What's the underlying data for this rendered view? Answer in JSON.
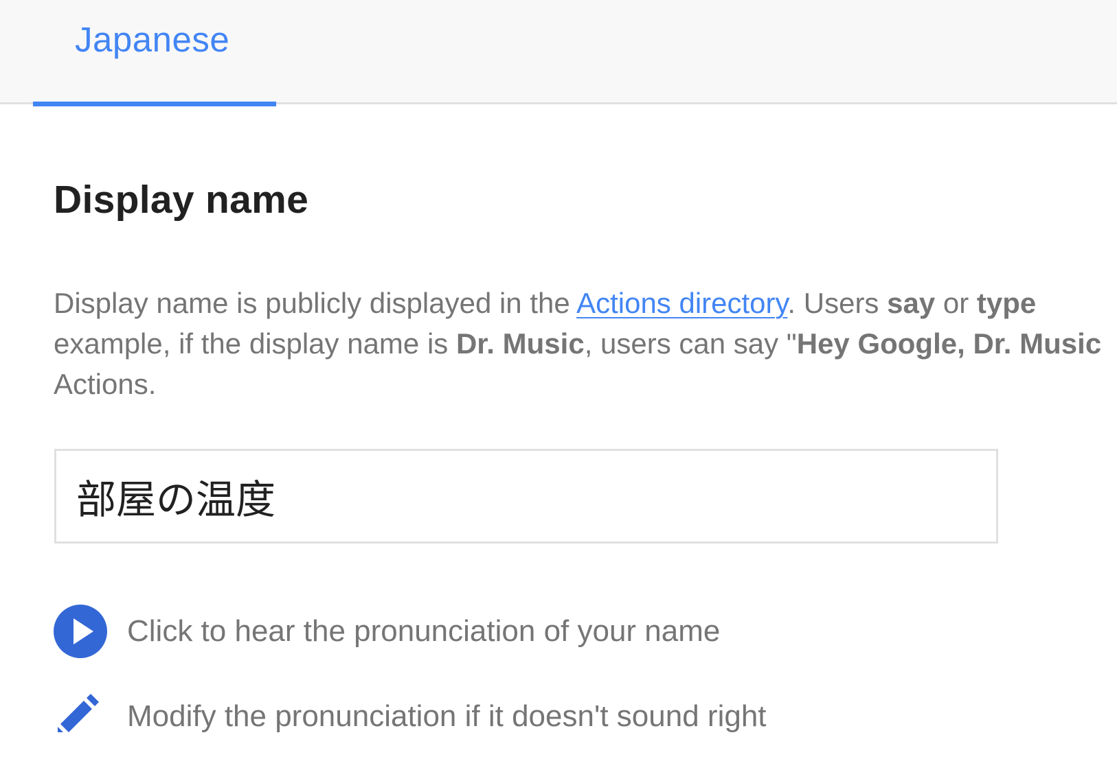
{
  "tabs": {
    "active_label": "Japanese"
  },
  "section": {
    "title": "Display name"
  },
  "description": {
    "line1_part1": "Display name is publicly displayed in the ",
    "line1_link": "Actions directory",
    "line1_part2": ". Users ",
    "line1_say": "say",
    "line1_part3": " or ",
    "line1_type": "type",
    "line2_part1": "example, if the display name is ",
    "line2_name": "Dr. Music",
    "line2_part2": ", users can say \"",
    "line2_phrase": "Hey Google, Dr. Music",
    "line3": "Actions."
  },
  "name_field": {
    "value": "部屋の温度"
  },
  "actions": {
    "play_label": "Click to hear the pronunciation of your name",
    "modify_label": "Modify the pronunciation if it doesn't sound right"
  },
  "colors": {
    "accent": "#4285f4",
    "play_button": "#3367d6",
    "text_primary": "#212121",
    "text_secondary": "#757575"
  },
  "icons": {
    "play": "play-icon",
    "edit": "pencil-icon"
  }
}
